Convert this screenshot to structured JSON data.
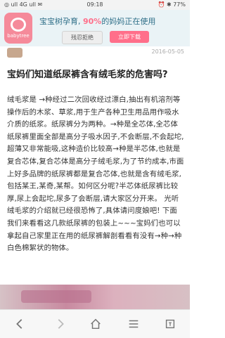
{
  "status_bar": {
    "left": "◎ ull 4G ull ✉",
    "time": "09:18",
    "right": "⏰ ✱ 77%"
  },
  "banner": {
    "logo_text": "babytree",
    "prompt_prefix": "宝宝树孕育, ",
    "prompt_highlight": "90%",
    "prompt_suffix": "的妈妈正在使用",
    "dismiss_label": "残忍拒绝",
    "open_label": "立即下载"
  },
  "post": {
    "date": "2016-05-05",
    "title": "宝妈们知道纸尿裤含有绒毛浆的危害吗?",
    "body": "绒毛浆是 →种经过二次回收经过漂白,抽出有机溶剂等操作后的木浆、草浆,用于生产各种卫生用品用作吸水介质的纸浆。纸尿裤分为两种。→种是全芯体,全芯体纸尿裤里面全部是高分子吸水因子,不会断层,不会起坨,超薄又非常能吸,这种造价比较高→种是半芯体,也就是复合芯体,复合芯体是高分子绒毛浆,为了节约成本,市面上好多品牌的纸尿裤都是复合芯体,也就是含有绒毛浆,包括某王,某奇,某帮。如何区分呢?半芯体纸尿裤比较厚,尿上会起坨,尿多了会断层,请大家区分开来。 光听绒毛浆的介绍就已经很恐怖了,具体请问度娘吧! 下面我们来看看这几款纸尿裤的包装上~~~宝妈们也可以拿起自己家里正在用的纸尿裤解剖看看有没有→种→种白色棉絮状的物体。"
  },
  "nav": {
    "icons": [
      "back-icon",
      "forward-icon",
      "home-icon",
      "menu-icon",
      "tabs-icon"
    ]
  }
}
